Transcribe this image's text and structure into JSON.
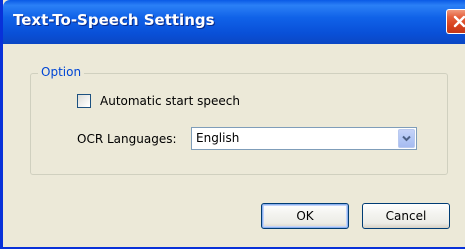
{
  "window": {
    "title": "Text-To-Speech Settings",
    "close_icon": "close-icon",
    "accent_color": "#0a5ae6",
    "close_color": "#d6401c"
  },
  "option_group": {
    "label": "Option",
    "label_color": "#0046d5",
    "auto_start": {
      "label": "Automatic start speech",
      "checked": false
    },
    "ocr_languages": {
      "label": "OCR Languages:",
      "selected": "English",
      "arrow_icon": "chevron-down-icon"
    }
  },
  "buttons": {
    "ok_label": "OK",
    "cancel_label": "Cancel"
  }
}
